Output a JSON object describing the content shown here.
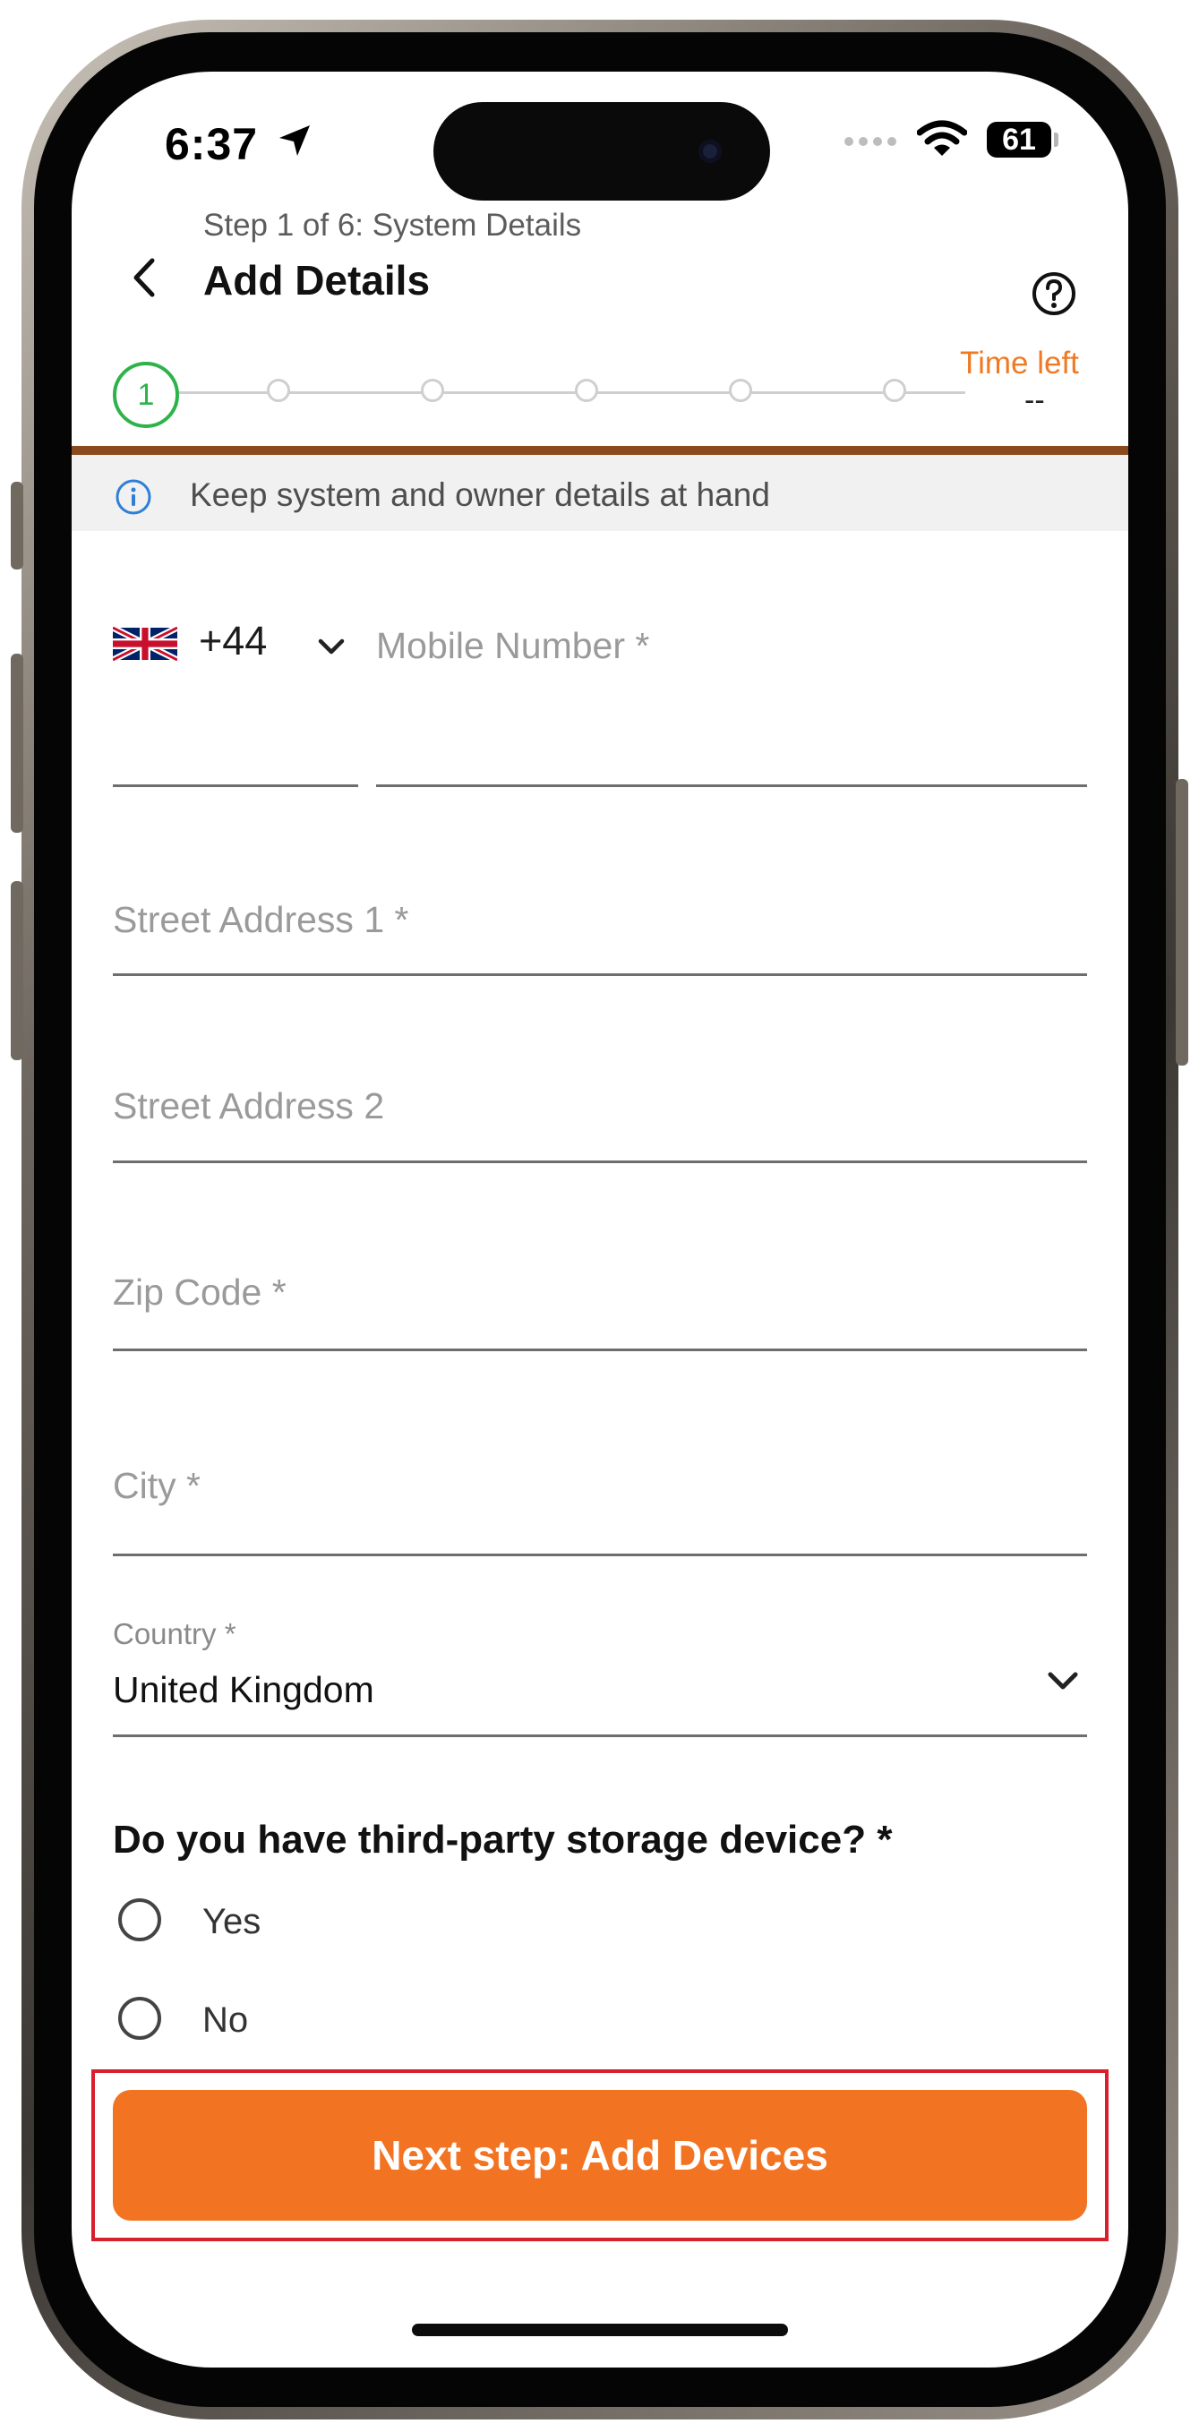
{
  "status_bar": {
    "time": "6:37",
    "battery": "61"
  },
  "header": {
    "step_label": "Step 1 of 6: System Details",
    "title": "Add Details",
    "time_left_label": "Time left",
    "time_left_value": "--"
  },
  "stepper": {
    "active_step": "1",
    "total_steps": 6
  },
  "banner": {
    "text": "Keep system and owner details at hand"
  },
  "phone": {
    "country_code": "+44",
    "flag": "uk-flag-icon",
    "placeholder": "Mobile Number *"
  },
  "fields": {
    "street1_placeholder": "Street Address 1 *",
    "street2_placeholder": "Street Address 2",
    "zip_placeholder": "Zip Code *",
    "city_placeholder": "City *",
    "country_label": "Country *",
    "country_value": "United Kingdom"
  },
  "question": {
    "text": "Do you have third-party storage device? *",
    "options": [
      "Yes",
      "No"
    ]
  },
  "cta": {
    "label": "Next step: Add Devices"
  },
  "colors": {
    "accent": "#f27422",
    "step_active": "#2eb34a",
    "progress": "#8b4a1e",
    "highlight": "#d81f2e"
  }
}
